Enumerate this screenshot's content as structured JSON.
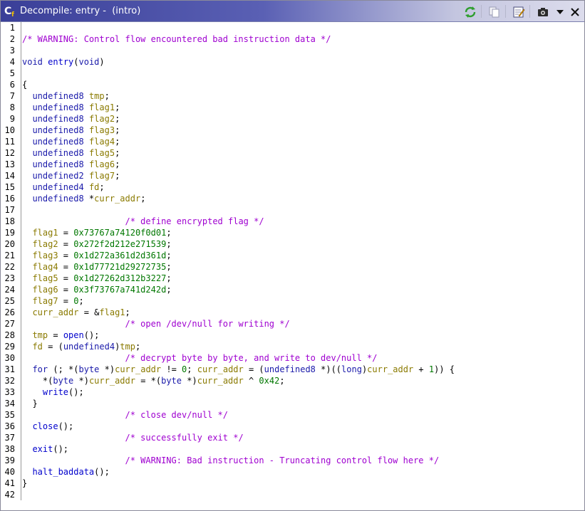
{
  "window": {
    "title": "Decompile: entry -  (intro)",
    "icon_label": "C",
    "icon_sub": "f"
  },
  "toolbar": {
    "buttons": [
      {
        "name": "refresh-icon",
        "label": "refresh"
      },
      {
        "name": "copy-icon",
        "label": "copy"
      },
      {
        "name": "edit-icon",
        "label": "edit function signature"
      },
      {
        "name": "snapshot-icon",
        "label": "snapshot"
      },
      {
        "name": "menu-dropdown-icon",
        "label": "more"
      },
      {
        "name": "close-icon",
        "label": "close"
      }
    ],
    "colors": {
      "refresh": "#2e9e2e",
      "accent": "#3a3f98"
    }
  },
  "lines": [
    {
      "n": "1",
      "t": []
    },
    {
      "n": "2",
      "t": [
        [
          "c",
          "/* WARNING: Control flow encountered bad instruction data */"
        ]
      ]
    },
    {
      "n": "3",
      "t": []
    },
    {
      "n": "4",
      "t": [
        [
          "t",
          "void"
        ],
        [
          "o",
          " "
        ],
        [
          "f",
          "entry"
        ],
        [
          "o",
          "("
        ],
        [
          "t",
          "void"
        ],
        [
          "o",
          ")"
        ]
      ]
    },
    {
      "n": "5",
      "t": []
    },
    {
      "n": "6",
      "t": [
        [
          "o",
          "{"
        ]
      ]
    },
    {
      "n": "7",
      "t": [
        [
          "o",
          "  "
        ],
        [
          "t",
          "undefined8"
        ],
        [
          "o",
          " "
        ],
        [
          "v",
          "tmp"
        ],
        [
          "o",
          ";"
        ]
      ]
    },
    {
      "n": "8",
      "t": [
        [
          "o",
          "  "
        ],
        [
          "t",
          "undefined8"
        ],
        [
          "o",
          " "
        ],
        [
          "v",
          "flag1"
        ],
        [
          "o",
          ";"
        ]
      ]
    },
    {
      "n": "9",
      "t": [
        [
          "o",
          "  "
        ],
        [
          "t",
          "undefined8"
        ],
        [
          "o",
          " "
        ],
        [
          "v",
          "flag2"
        ],
        [
          "o",
          ";"
        ]
      ]
    },
    {
      "n": "10",
      "t": [
        [
          "o",
          "  "
        ],
        [
          "t",
          "undefined8"
        ],
        [
          "o",
          " "
        ],
        [
          "v",
          "flag3"
        ],
        [
          "o",
          ";"
        ]
      ]
    },
    {
      "n": "11",
      "t": [
        [
          "o",
          "  "
        ],
        [
          "t",
          "undefined8"
        ],
        [
          "o",
          " "
        ],
        [
          "v",
          "flag4"
        ],
        [
          "o",
          ";"
        ]
      ]
    },
    {
      "n": "12",
      "t": [
        [
          "o",
          "  "
        ],
        [
          "t",
          "undefined8"
        ],
        [
          "o",
          " "
        ],
        [
          "v",
          "flag5"
        ],
        [
          "o",
          ";"
        ]
      ]
    },
    {
      "n": "13",
      "t": [
        [
          "o",
          "  "
        ],
        [
          "t",
          "undefined8"
        ],
        [
          "o",
          " "
        ],
        [
          "v",
          "flag6"
        ],
        [
          "o",
          ";"
        ]
      ]
    },
    {
      "n": "14",
      "t": [
        [
          "o",
          "  "
        ],
        [
          "t",
          "undefined2"
        ],
        [
          "o",
          " "
        ],
        [
          "v",
          "flag7"
        ],
        [
          "o",
          ";"
        ]
      ]
    },
    {
      "n": "15",
      "t": [
        [
          "o",
          "  "
        ],
        [
          "t",
          "undefined4"
        ],
        [
          "o",
          " "
        ],
        [
          "v",
          "fd"
        ],
        [
          "o",
          ";"
        ]
      ]
    },
    {
      "n": "16",
      "t": [
        [
          "o",
          "  "
        ],
        [
          "t",
          "undefined8"
        ],
        [
          "o",
          " *"
        ],
        [
          "v",
          "curr_addr"
        ],
        [
          "o",
          ";"
        ]
      ]
    },
    {
      "n": "17",
      "t": []
    },
    {
      "n": "18",
      "t": [
        [
          "o",
          "                    "
        ],
        [
          "c",
          "/* define encrypted flag */"
        ]
      ]
    },
    {
      "n": "19",
      "t": [
        [
          "o",
          "  "
        ],
        [
          "v",
          "flag1"
        ],
        [
          "o",
          " = "
        ],
        [
          "n",
          "0x73767a74120f0d01"
        ],
        [
          "o",
          ";"
        ]
      ]
    },
    {
      "n": "20",
      "t": [
        [
          "o",
          "  "
        ],
        [
          "v",
          "flag2"
        ],
        [
          "o",
          " = "
        ],
        [
          "n",
          "0x272f2d212e271539"
        ],
        [
          "o",
          ";"
        ]
      ]
    },
    {
      "n": "21",
      "t": [
        [
          "o",
          "  "
        ],
        [
          "v",
          "flag3"
        ],
        [
          "o",
          " = "
        ],
        [
          "n",
          "0x1d272a361d2d361d"
        ],
        [
          "o",
          ";"
        ]
      ]
    },
    {
      "n": "22",
      "t": [
        [
          "o",
          "  "
        ],
        [
          "v",
          "flag4"
        ],
        [
          "o",
          " = "
        ],
        [
          "n",
          "0x1d77721d29272735"
        ],
        [
          "o",
          ";"
        ]
      ]
    },
    {
      "n": "23",
      "t": [
        [
          "o",
          "  "
        ],
        [
          "v",
          "flag5"
        ],
        [
          "o",
          " = "
        ],
        [
          "n",
          "0x1d27262d312b3227"
        ],
        [
          "o",
          ";"
        ]
      ]
    },
    {
      "n": "24",
      "t": [
        [
          "o",
          "  "
        ],
        [
          "v",
          "flag6"
        ],
        [
          "o",
          " = "
        ],
        [
          "n",
          "0x3f73767a741d242d"
        ],
        [
          "o",
          ";"
        ]
      ]
    },
    {
      "n": "25",
      "t": [
        [
          "o",
          "  "
        ],
        [
          "v",
          "flag7"
        ],
        [
          "o",
          " = "
        ],
        [
          "n",
          "0"
        ],
        [
          "o",
          ";"
        ]
      ]
    },
    {
      "n": "26",
      "t": [
        [
          "o",
          "  "
        ],
        [
          "v",
          "curr_addr"
        ],
        [
          "o",
          " = &"
        ],
        [
          "v",
          "flag1"
        ],
        [
          "o",
          ";"
        ]
      ]
    },
    {
      "n": "27",
      "t": [
        [
          "o",
          "                    "
        ],
        [
          "c",
          "/* open /dev/null for writing */"
        ]
      ]
    },
    {
      "n": "28",
      "t": [
        [
          "o",
          "  "
        ],
        [
          "v",
          "tmp"
        ],
        [
          "o",
          " = "
        ],
        [
          "f",
          "open"
        ],
        [
          "o",
          "();"
        ]
      ]
    },
    {
      "n": "29",
      "t": [
        [
          "o",
          "  "
        ],
        [
          "v",
          "fd"
        ],
        [
          "o",
          " = ("
        ],
        [
          "t",
          "undefined4"
        ],
        [
          "o",
          ")"
        ],
        [
          "v",
          "tmp"
        ],
        [
          "o",
          ";"
        ]
      ]
    },
    {
      "n": "30",
      "t": [
        [
          "o",
          "                    "
        ],
        [
          "c",
          "/* decrypt byte by byte, and write to dev/null */"
        ]
      ]
    },
    {
      "n": "31",
      "t": [
        [
          "o",
          "  "
        ],
        [
          "t",
          "for"
        ],
        [
          "o",
          " (; *("
        ],
        [
          "t",
          "byte"
        ],
        [
          "o",
          " *)"
        ],
        [
          "v",
          "curr_addr"
        ],
        [
          "o",
          " != "
        ],
        [
          "n",
          "0"
        ],
        [
          "o",
          "; "
        ],
        [
          "v",
          "curr_addr"
        ],
        [
          "o",
          " = ("
        ],
        [
          "t",
          "undefined8"
        ],
        [
          "o",
          " *)(("
        ],
        [
          "t",
          "long"
        ],
        [
          "o",
          ")"
        ],
        [
          "v",
          "curr_addr"
        ],
        [
          "o",
          " + "
        ],
        [
          "n",
          "1"
        ],
        [
          "o",
          ")) {"
        ]
      ]
    },
    {
      "n": "32",
      "t": [
        [
          "o",
          "    *("
        ],
        [
          "t",
          "byte"
        ],
        [
          "o",
          " *)"
        ],
        [
          "v",
          "curr_addr"
        ],
        [
          "o",
          " = *("
        ],
        [
          "t",
          "byte"
        ],
        [
          "o",
          " *)"
        ],
        [
          "v",
          "curr_addr"
        ],
        [
          "o",
          " ^ "
        ],
        [
          "n",
          "0x42"
        ],
        [
          "o",
          ";"
        ]
      ]
    },
    {
      "n": "33",
      "t": [
        [
          "o",
          "    "
        ],
        [
          "f",
          "write"
        ],
        [
          "o",
          "();"
        ]
      ]
    },
    {
      "n": "34",
      "t": [
        [
          "o",
          "  }"
        ]
      ]
    },
    {
      "n": "35",
      "t": [
        [
          "o",
          "                    "
        ],
        [
          "c",
          "/* close dev/null */"
        ]
      ]
    },
    {
      "n": "36",
      "t": [
        [
          "o",
          "  "
        ],
        [
          "f",
          "close"
        ],
        [
          "o",
          "();"
        ]
      ]
    },
    {
      "n": "37",
      "t": [
        [
          "o",
          "                    "
        ],
        [
          "c",
          "/* successfully exit */"
        ]
      ]
    },
    {
      "n": "38",
      "t": [
        [
          "o",
          "  "
        ],
        [
          "f",
          "exit"
        ],
        [
          "o",
          "();"
        ]
      ]
    },
    {
      "n": "39",
      "t": [
        [
          "o",
          "                    "
        ],
        [
          "c",
          "/* WARNING: Bad instruction - Truncating control flow here */"
        ]
      ]
    },
    {
      "n": "40",
      "t": [
        [
          "o",
          "  "
        ],
        [
          "f",
          "halt_baddata"
        ],
        [
          "o",
          "();"
        ]
      ]
    },
    {
      "n": "41",
      "t": [
        [
          "o",
          "}"
        ]
      ]
    },
    {
      "n": "42",
      "t": []
    }
  ]
}
